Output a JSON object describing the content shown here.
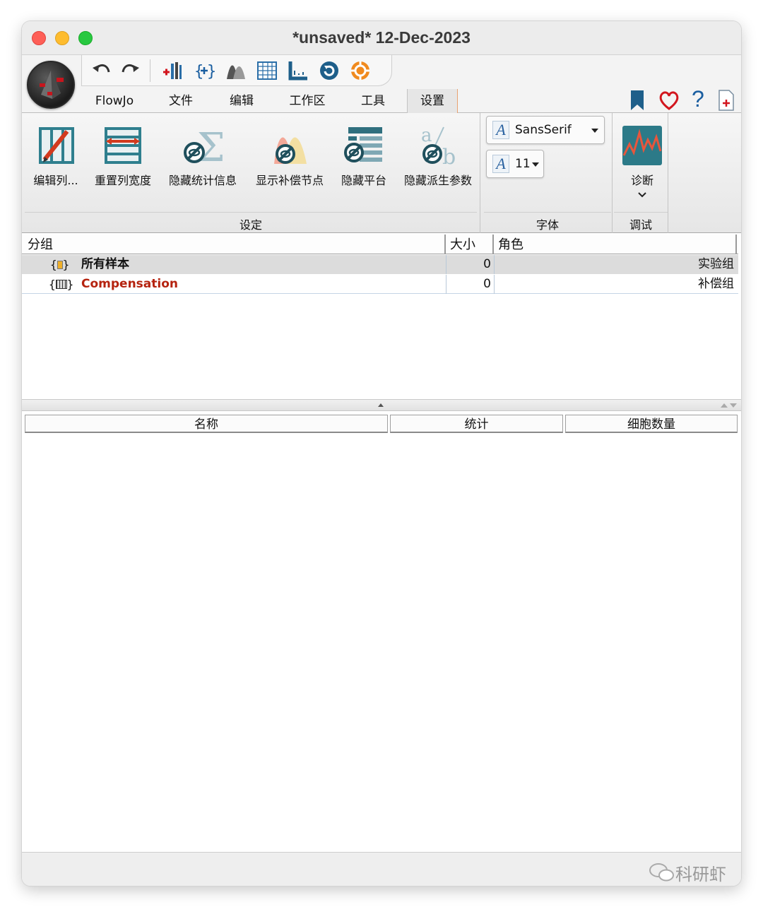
{
  "window": {
    "title": "*unsaved* 12-Dec-2023"
  },
  "menu": {
    "tabs": [
      "FlowJo",
      "文件",
      "编辑",
      "工作区",
      "工具",
      "设置"
    ],
    "active_tab": "设置"
  },
  "ribbon": {
    "settings_group": {
      "label": "设定",
      "buttons": [
        "编辑列...",
        "重置列宽度",
        "隐藏统计信息",
        "显示补偿节点",
        "隐藏平台",
        "隐藏派生参数"
      ]
    },
    "font_group": {
      "label": "字体",
      "font_name": "SansSerif",
      "font_size": "11"
    },
    "debug_group": {
      "label": "调试",
      "diagnose_label": "诊断"
    }
  },
  "groups_table": {
    "headers": [
      "分组",
      "大小",
      "角色"
    ],
    "rows": [
      {
        "name": "所有样本",
        "size": "0",
        "role": "实验组",
        "name_color": "#111111"
      },
      {
        "name": "Compensation",
        "size": "0",
        "role": "补偿组",
        "name_color": "#b5230f"
      }
    ]
  },
  "stats_table": {
    "headers": [
      "名称",
      "统计",
      "细胞数量"
    ]
  },
  "watermark": "科研虾",
  "colors": {
    "accent_red": "#b5230f",
    "teal": "#1e6b7a",
    "orange": "#f08a1e"
  }
}
